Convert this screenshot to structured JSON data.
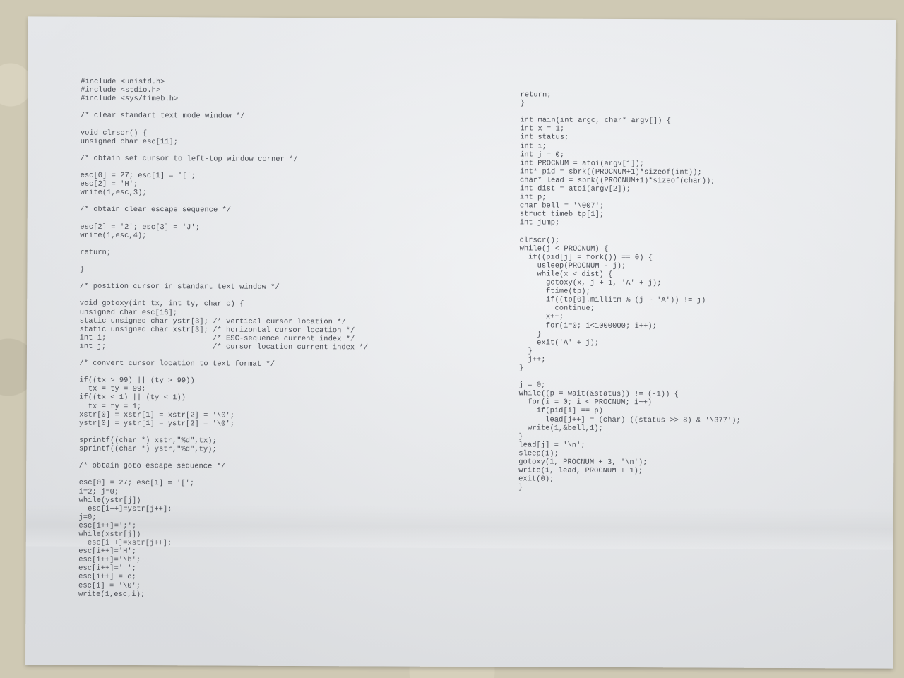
{
  "page": {
    "left_column": [
      "  #include <unistd.h>",
      "  #include <stdio.h>",
      "  #include <sys/timeb.h>",
      "",
      "  /* clear standart text mode window */",
      "",
      "  void clrscr() {",
      "  unsigned char esc[11];",
      "",
      "  /* obtain set cursor to left-top window corner */",
      "",
      "  esc[0] = 27; esc[1] = '[';",
      "  esc[2] = 'H';",
      "  write(1,esc,3);",
      "",
      "  /* obtain clear escape sequence */",
      "",
      "  esc[2] = '2'; esc[3] = 'J';",
      "  write(1,esc,4);",
      "",
      "  return;",
      "",
      "  }",
      "",
      "  /* position cursor in standart text window */",
      "",
      "  void gotoxy(int tx, int ty, char c) {",
      "  unsigned char esc[16];",
      "  static unsigned char ystr[3]; /* vertical cursor location */",
      "  static unsigned char xstr[3]; /* horizontal cursor location */",
      "  int i;                        /* ESC-sequence current index */",
      "  int j;                        /* cursor location current index */",
      "",
      "  /* convert cursor location to text format */",
      "",
      "  if((tx > 99) || (ty > 99))",
      "    tx = ty = 99;",
      "  if((tx < 1) || (ty < 1))",
      "    tx = ty = 1;",
      "  xstr[0] = xstr[1] = xstr[2] = '\\0';",
      "  ystr[0] = ystr[1] = ystr[2] = '\\0';",
      "",
      "  sprintf((char *) xstr,\"%d\",tx);",
      "  sprintf((char *) ystr,\"%d\",ty);",
      "",
      "  /* obtain goto escape sequence */",
      "",
      "  esc[0] = 27; esc[1] = '[';",
      "  i=2; j=0;",
      "  while(ystr[j])",
      "    esc[i++]=ystr[j++];",
      "  j=0;",
      "  esc[i++]=';';",
      "  while(xstr[j])",
      "    esc[i++]=xstr[j++];",
      "  esc[i++]='H';",
      "  esc[i++]='\\b';",
      "  esc[i++]=' ';",
      "  esc[i++] = c;",
      "  esc[i] = '\\0';",
      "  write(1,esc,i);"
    ],
    "right_column": [
      "return;",
      "}",
      "",
      "int main(int argc, char* argv[]) {",
      "int x = 1;",
      "int status;",
      "int i;",
      "int j = 0;",
      "int PROCNUM = atoi(argv[1]);",
      "int* pid = sbrk((PROCNUM+1)*sizeof(int));",
      "char* lead = sbrk((PROCNUM+1)*sizeof(char));",
      "int dist = atoi(argv[2]);",
      "int p;",
      "char bell = '\\007';",
      "struct timeb tp[1];",
      "int jump;",
      "",
      "clrscr();",
      "while(j < PROCNUM) {",
      "  if((pid[j] = fork()) == 0) {",
      "    usleep(PROCNUM - j);",
      "    while(x < dist) {",
      "      gotoxy(x, j + 1, 'A' + j);",
      "      ftime(tp);",
      "      if((tp[0].millitm % (j + 'A')) != j)",
      "        continue;",
      "      x++;",
      "      for(i=0; i<1000000; i++);",
      "    }",
      "    exit('A' + j);",
      "  }",
      "  j++;",
      "}",
      "",
      "j = 0;",
      "while((p = wait(&status)) != (-1)) {",
      "  for(i = 0; i < PROCNUM; i++)",
      "    if(pid[i] == p)",
      "      lead[j++] = (char) ((status >> 8) & '\\377');",
      "  write(1,&bell,1);",
      "}",
      "lead[j] = '\\n';",
      "sleep(1);",
      "gotoxy(1, PROCNUM + 3, '\\n');",
      "write(1, lead, PROCNUM + 1);",
      "exit(0);",
      "}"
    ]
  }
}
